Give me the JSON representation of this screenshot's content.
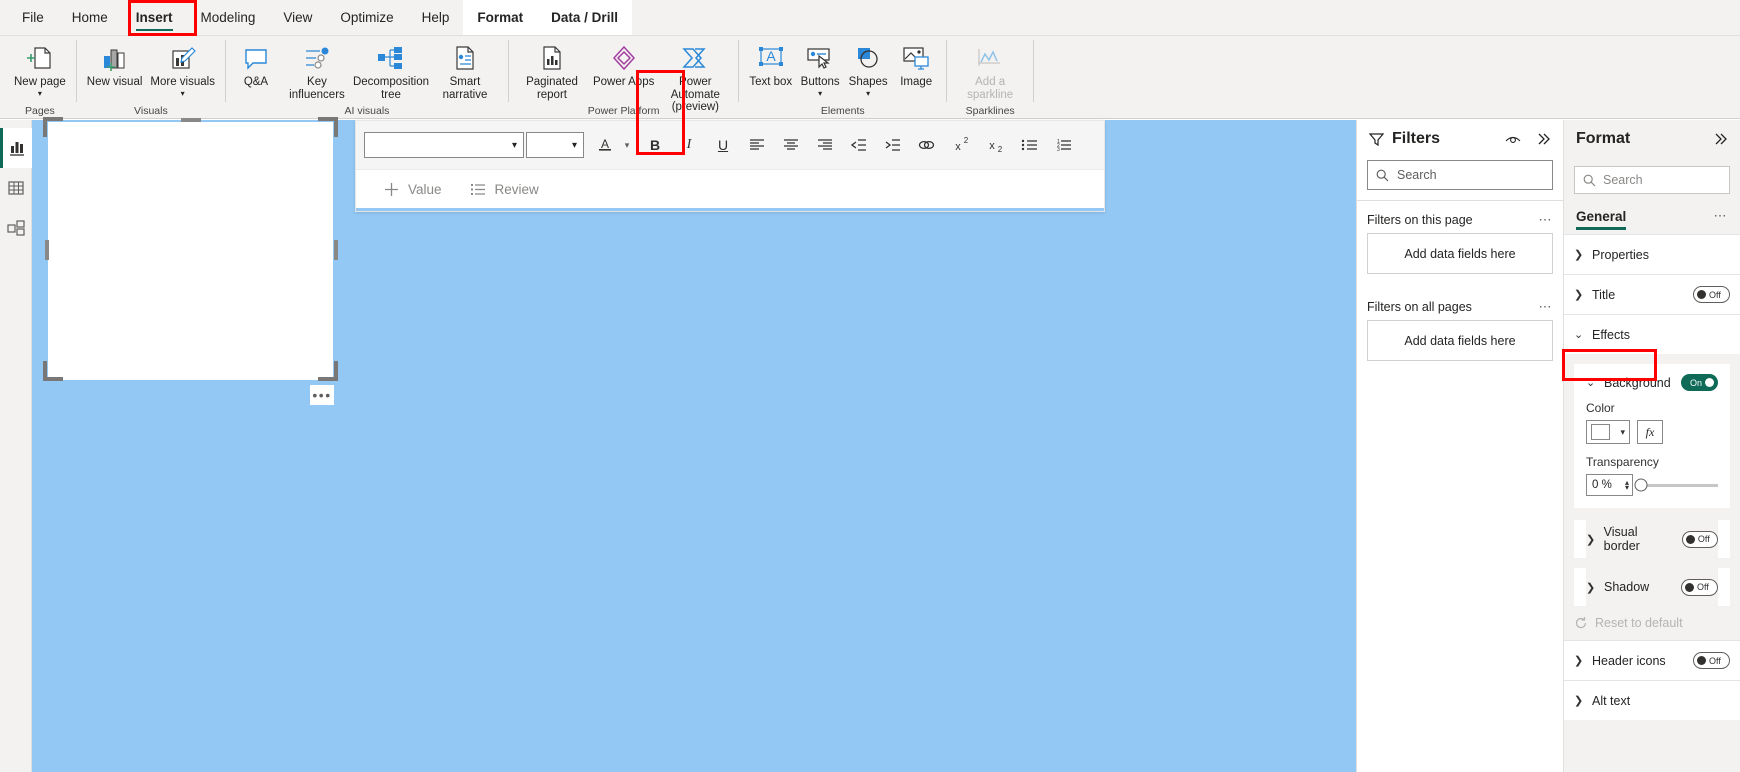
{
  "ribbon": {
    "tabs": [
      {
        "label": "File",
        "state": "normal"
      },
      {
        "label": "Home",
        "state": "normal"
      },
      {
        "label": "Insert",
        "state": "active"
      },
      {
        "label": "Modeling",
        "state": "normal"
      },
      {
        "label": "View",
        "state": "normal"
      },
      {
        "label": "Optimize",
        "state": "normal"
      },
      {
        "label": "Help",
        "state": "normal"
      },
      {
        "label": "Format",
        "state": "contextual"
      },
      {
        "label": "Data / Drill",
        "state": "contextual"
      }
    ],
    "groups": [
      {
        "label": "Pages",
        "buttons": [
          {
            "label": "New page",
            "icon": "new-page-icon",
            "caret": true,
            "disabled": false
          }
        ]
      },
      {
        "label": "Visuals",
        "buttons": [
          {
            "label": "New visual",
            "icon": "new-visual-icon",
            "caret": false,
            "disabled": false
          },
          {
            "label": "More visuals",
            "icon": "more-visuals-icon",
            "caret": true,
            "disabled": false
          }
        ]
      },
      {
        "label": "AI visuals",
        "buttons": [
          {
            "label": "Q&A",
            "icon": "qa-icon",
            "caret": false,
            "disabled": false
          },
          {
            "label": "Key influencers",
            "icon": "key-influencers-icon",
            "caret": false,
            "disabled": false
          },
          {
            "label": "Decomposition tree",
            "icon": "decomposition-tree-icon",
            "caret": false,
            "disabled": false
          },
          {
            "label": "Smart narrative",
            "icon": "smart-narrative-icon",
            "caret": false,
            "disabled": false
          }
        ]
      },
      {
        "label": "Power Platform",
        "buttons": [
          {
            "label": "Paginated report",
            "icon": "paginated-report-icon",
            "caret": false,
            "disabled": false
          },
          {
            "label": "Power Apps",
            "icon": "power-apps-icon",
            "caret": false,
            "disabled": false
          },
          {
            "label": "Power Automate (preview)",
            "icon": "power-automate-icon",
            "caret": false,
            "disabled": false
          }
        ]
      },
      {
        "label": "Elements",
        "buttons": [
          {
            "label": "Text box",
            "icon": "text-box-icon",
            "caret": false,
            "disabled": false,
            "highlighted": true
          },
          {
            "label": "Buttons",
            "icon": "buttons-icon",
            "caret": true,
            "disabled": false
          },
          {
            "label": "Shapes",
            "icon": "shapes-icon",
            "caret": true,
            "disabled": false
          },
          {
            "label": "Image",
            "icon": "image-icon",
            "caret": false,
            "disabled": false
          }
        ]
      },
      {
        "label": "Sparklines",
        "buttons": [
          {
            "label": "Add a sparkline",
            "icon": "sparkline-icon",
            "caret": false,
            "disabled": true
          }
        ]
      }
    ]
  },
  "view_rail": {
    "items": [
      {
        "name": "report-view",
        "icon": "report-view-icon",
        "selected": true
      },
      {
        "name": "data-view",
        "icon": "table-view-icon",
        "selected": false
      },
      {
        "name": "model-view",
        "icon": "model-view-icon",
        "selected": false
      }
    ]
  },
  "format_toolbar": {
    "font_name": "",
    "font_name_placeholder": "",
    "font_size": "",
    "font_size_placeholder": "",
    "buttons": [
      {
        "name": "font-color-button",
        "glyph": "A"
      },
      {
        "name": "font-color-chevron",
        "glyph": "⌄"
      },
      {
        "name": "bold-button",
        "glyph": "B"
      },
      {
        "name": "italic-button",
        "glyph": "I"
      },
      {
        "name": "underline-button",
        "glyph": "U"
      },
      {
        "name": "align-left-button",
        "glyph": "≡"
      },
      {
        "name": "align-center-button",
        "glyph": "≡"
      },
      {
        "name": "align-right-button",
        "glyph": "≡"
      },
      {
        "name": "decrease-indent-button",
        "glyph": "←"
      },
      {
        "name": "increase-indent-button",
        "glyph": "→"
      },
      {
        "name": "insert-link-button",
        "glyph": "⚭"
      },
      {
        "name": "superscript-button",
        "glyph": "x²"
      },
      {
        "name": "subscript-button",
        "glyph": "x₂"
      },
      {
        "name": "bulleted-list-button",
        "glyph": "•≡"
      },
      {
        "name": "numbered-list-button",
        "glyph": "1≡"
      }
    ],
    "fields": [
      {
        "label": "Value",
        "icon": "plus-icon"
      },
      {
        "label": "Review",
        "icon": "list-icon"
      }
    ]
  },
  "canvas": {
    "background_color": "#93c8f5",
    "textbox": {
      "background_color": "#ffffff"
    },
    "more_options_label": "•••"
  },
  "filters_pane": {
    "title": "Filters",
    "search_placeholder": "Search",
    "sections": [
      {
        "label": "Filters on this page",
        "dropzone": "Add data fields here",
        "menu": "…"
      },
      {
        "label": "Filters on all pages",
        "dropzone": "Add data fields here",
        "menu": "…"
      }
    ],
    "icons": {
      "filter": "filter-icon",
      "eye": "hide-filters-icon",
      "collapse": "collapse-pane-icon"
    }
  },
  "format_pane": {
    "title": "Format",
    "collapse_icon": "collapse-pane-icon",
    "search_placeholder": "Search",
    "tabs": [
      {
        "label": "General",
        "active": true
      }
    ],
    "menu": "…",
    "sections": [
      {
        "name": "properties",
        "label": "Properties",
        "expanded": false,
        "toggle": null
      },
      {
        "name": "title",
        "label": "Title",
        "expanded": false,
        "toggle": "Off"
      },
      {
        "name": "effects",
        "label": "Effects",
        "expanded": true,
        "toggle": null,
        "highlighted": true
      }
    ],
    "effects": {
      "background": {
        "label": "Background",
        "toggle": "On",
        "toggle_state": true,
        "color_label": "Color",
        "color_value": "#ffffff",
        "fx_label": "fx",
        "transparency_label": "Transparency",
        "transparency_value": "0 %"
      }
    },
    "more_sections": [
      {
        "name": "visual-border",
        "label": "Visual border",
        "toggle": "Off"
      },
      {
        "name": "shadow",
        "label": "Shadow",
        "toggle": "Off"
      }
    ],
    "reset_label": "Reset to default",
    "tail_sections": [
      {
        "name": "header-icons",
        "label": "Header icons",
        "toggle": "Off"
      },
      {
        "name": "alt-text",
        "label": "Alt text",
        "toggle": null
      }
    ]
  },
  "colors": {
    "accent_green": "#0f6b58",
    "highlight_red": "#ff0000",
    "canvas_blue": "#93c8f5",
    "chrome_gray": "#f3f2f1"
  }
}
